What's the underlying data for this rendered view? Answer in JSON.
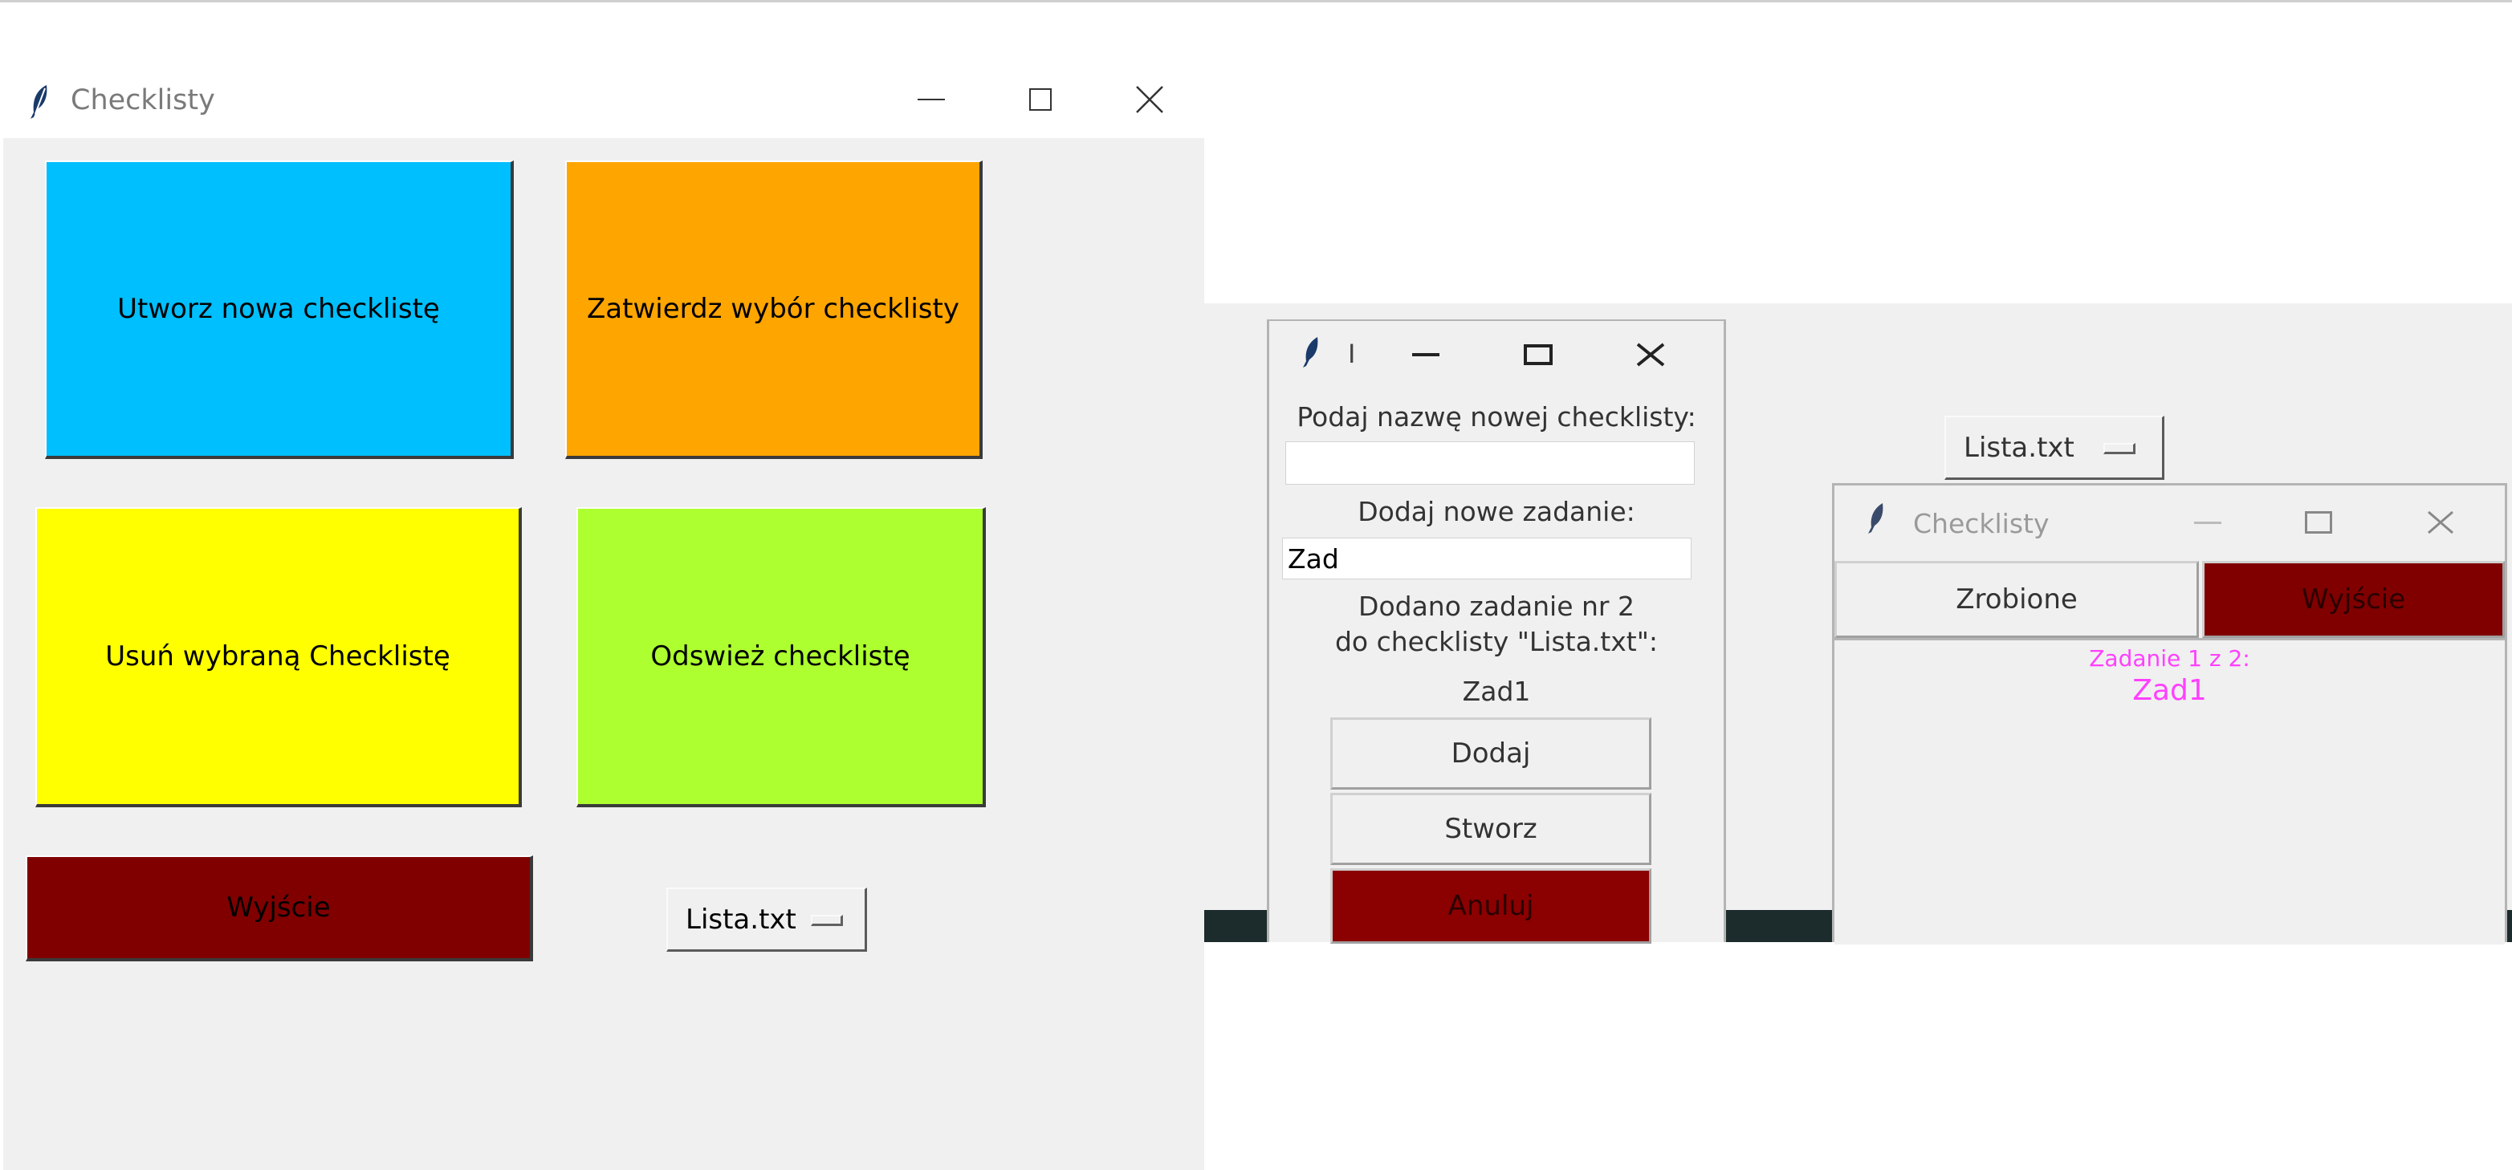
{
  "main_window": {
    "title": "Checklisty",
    "buttons": {
      "create": "Utworz nowa checklistę",
      "confirm": "Zatwierdz wybór checklisty",
      "delete": "Usuń wybraną Checklistę",
      "refresh": "Odswież checklistę",
      "exit": "Wyjście"
    },
    "list_menu_value": "Lista.txt"
  },
  "new_checklist_window": {
    "title": "I",
    "name_label": "Podaj nazwę nowej checklisty:",
    "name_value": "",
    "task_label": "Dodaj nowe zadanie:",
    "task_value": "Zad",
    "status_line1": "Dodano zadanie nr 2",
    "status_line2": "do checklisty \"Lista.txt\":",
    "last_task": "Zad1",
    "buttons": {
      "add": "Dodaj",
      "create": "Stworz",
      "cancel": "Anuluj"
    }
  },
  "background_menu_value": "Lista.txt",
  "checklist_window": {
    "title": "Checklisty",
    "done_button": "Zrobione",
    "exit_button": "Wyjście",
    "task_counter": "Zadanie 1 z 2:",
    "task_name": "Zad1"
  },
  "colors": {
    "create": "#00bfff",
    "confirm": "#ffa500",
    "delete": "#ffff00",
    "refresh": "#adff2f",
    "exit": "#800000",
    "task_text": "#ff40ff"
  }
}
